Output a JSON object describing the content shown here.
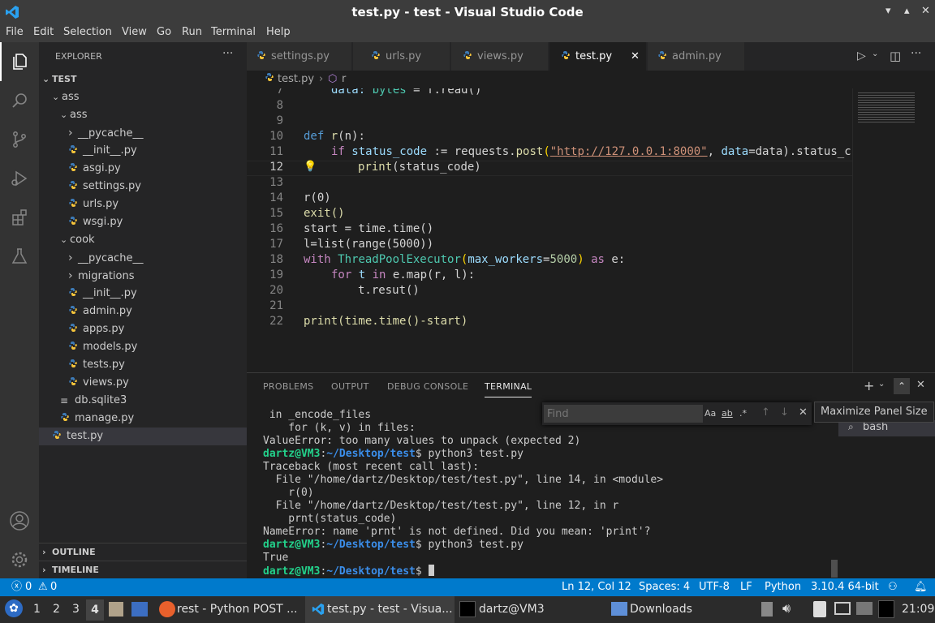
{
  "window": {
    "title": "test.py - test - Visual Studio Code"
  },
  "menu": [
    "File",
    "Edit",
    "Selection",
    "View",
    "Go",
    "Run",
    "Terminal",
    "Help"
  ],
  "explorer": {
    "header": "EXPLORER",
    "root": "TEST",
    "tree": [
      {
        "label": "ass",
        "depth": 1,
        "kind": "folder-open"
      },
      {
        "label": "ass",
        "depth": 2,
        "kind": "folder-open"
      },
      {
        "label": "__pycache__",
        "depth": 3,
        "kind": "folder"
      },
      {
        "label": "__init__.py",
        "depth": 3,
        "kind": "py"
      },
      {
        "label": "asgi.py",
        "depth": 3,
        "kind": "py"
      },
      {
        "label": "settings.py",
        "depth": 3,
        "kind": "py"
      },
      {
        "label": "urls.py",
        "depth": 3,
        "kind": "py"
      },
      {
        "label": "wsgi.py",
        "depth": 3,
        "kind": "py"
      },
      {
        "label": "cook",
        "depth": 2,
        "kind": "folder-open"
      },
      {
        "label": "__pycache__",
        "depth": 3,
        "kind": "folder"
      },
      {
        "label": "migrations",
        "depth": 3,
        "kind": "folder"
      },
      {
        "label": "__init__.py",
        "depth": 3,
        "kind": "py"
      },
      {
        "label": "admin.py",
        "depth": 3,
        "kind": "py"
      },
      {
        "label": "apps.py",
        "depth": 3,
        "kind": "py"
      },
      {
        "label": "models.py",
        "depth": 3,
        "kind": "py"
      },
      {
        "label": "tests.py",
        "depth": 3,
        "kind": "py"
      },
      {
        "label": "views.py",
        "depth": 3,
        "kind": "py"
      },
      {
        "label": "db.sqlite3",
        "depth": 2,
        "kind": "db"
      },
      {
        "label": "manage.py",
        "depth": 2,
        "kind": "py"
      },
      {
        "label": "test.py",
        "depth": 1,
        "kind": "py",
        "selected": true
      }
    ],
    "outline": "OUTLINE",
    "timeline": "TIMELINE"
  },
  "tabs": [
    {
      "label": "settings.py",
      "active": false
    },
    {
      "label": "urls.py",
      "active": false
    },
    {
      "label": "views.py",
      "active": false
    },
    {
      "label": "test.py",
      "active": true
    },
    {
      "label": "admin.py",
      "active": false
    }
  ],
  "breadcrumb": {
    "file": "test.py",
    "symbol": "r"
  },
  "editor": {
    "line_numbers": [
      "7",
      "8",
      "9",
      "10",
      "11",
      "12",
      "13",
      "14",
      "15",
      "16",
      "17",
      "18",
      "19",
      "20",
      "21",
      "22"
    ],
    "current_line": "12",
    "code": {
      "l7a": "data: ",
      "l7b": "bytes",
      "l7c": " = f.read()",
      "l10_def": "def",
      "l10_name": "r",
      "l10_rest": "(n):",
      "l11_if": "if",
      "l11_var": "status_code",
      "l11_op": " := requests.",
      "l11_fn": "post",
      "l11_str": "\"http://127.0.0.1:8000\"",
      "l11_rest1": ", ",
      "l11_kw": "data",
      "l11_rest2": "=data).status_c",
      "l12_fn": "print",
      "l12_rest": "(status_code)",
      "l14": "r(0)",
      "l15": "exit()",
      "l16": "start = time.time()",
      "l17": "l=list(range(5000))",
      "l18_with": "with",
      "l18_cls": "ThreadPoolExecutor",
      "l18_p": "max_workers",
      "l18_num": "5000",
      "l18_as": "as",
      "l18_e": "e:",
      "l19_for": "for",
      "l19_t": "t",
      "l19_in": "in",
      "l19_rest": "e.map(r, l):",
      "l20": "t.resut()",
      "l22": "print(time.time()-start)"
    }
  },
  "panel": {
    "tabs": [
      "PROBLEMS",
      "OUTPUT",
      "DEBUG CONSOLE",
      "TERMINAL"
    ],
    "active_tab": "TERMINAL",
    "terminal_lines": [
      " in _encode_files",
      "    for (k, v) in files:",
      "ValueError: too many values to unpack (expected 2)",
      "Traceback (most recent call last):",
      "  File \"/home/dartz/Desktop/test/test.py\", line 14, in <module>",
      "    r(0)",
      "  File \"/home/dartz/Desktop/test/test.py\", line 12, in r",
      "    prnt(status_code)",
      "NameError: name 'prnt' is not defined. Did you mean: 'print'?",
      "True"
    ],
    "prompt_user": "dartz@VM3",
    "prompt_path": "~/Desktop/test",
    "prompt_cmd": "$ python3 test.py",
    "prompt_end": "$",
    "find_placeholder": "Find",
    "find_opts": [
      "Aa",
      "ab",
      ".*"
    ],
    "terminal_name": "bash",
    "tooltip": "Maximize Panel Size"
  },
  "status": {
    "errors": "0",
    "warnings": "0",
    "position": "Ln 12, Col 12",
    "spaces": "Spaces: 4",
    "encoding": "UTF-8",
    "eol": "LF",
    "language": "Python",
    "interpreter": "3.10.4 64-bit"
  },
  "taskbar": {
    "workspaces": [
      "1",
      "2",
      "3",
      "4"
    ],
    "apps": [
      {
        "label": "rest - Python POST ..."
      },
      {
        "label": "test.py - test - Visua..."
      },
      {
        "label": "dartz@VM3"
      },
      {
        "label": "Downloads"
      }
    ],
    "clock": "21:09"
  },
  "colors": {
    "accent": "#007acc",
    "titlebar": "#3c3c3c",
    "editor_bg": "#1e1e1e",
    "sidebar_bg": "#252526"
  }
}
